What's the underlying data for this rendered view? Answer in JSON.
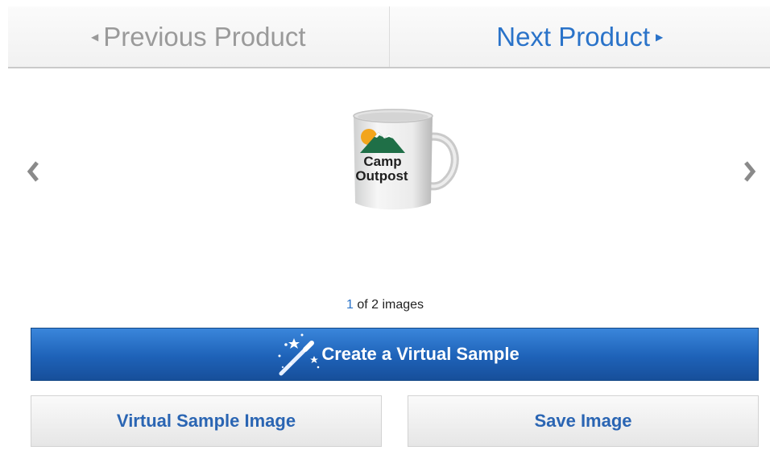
{
  "nav": {
    "previous_label": "Previous Product",
    "next_label": "Next Product"
  },
  "product": {
    "logo_line1": "Camp",
    "logo_line2": "Outpost"
  },
  "counter": {
    "current": "1",
    "rest": "of 2 images"
  },
  "actions": {
    "create_label": "Create a Virtual Sample",
    "virtual_sample_image_label": "Virtual Sample Image",
    "save_image_label": "Save Image"
  },
  "colors": {
    "accent_blue": "#2a73c9",
    "create_button_top": "#3a86db",
    "create_button_bottom": "#174f9a",
    "muted_gray": "#9a9a9a"
  },
  "icons": {
    "prev_image": "chevron-left-icon",
    "next_image": "chevron-right-icon",
    "wand": "magic-wand-icon"
  }
}
